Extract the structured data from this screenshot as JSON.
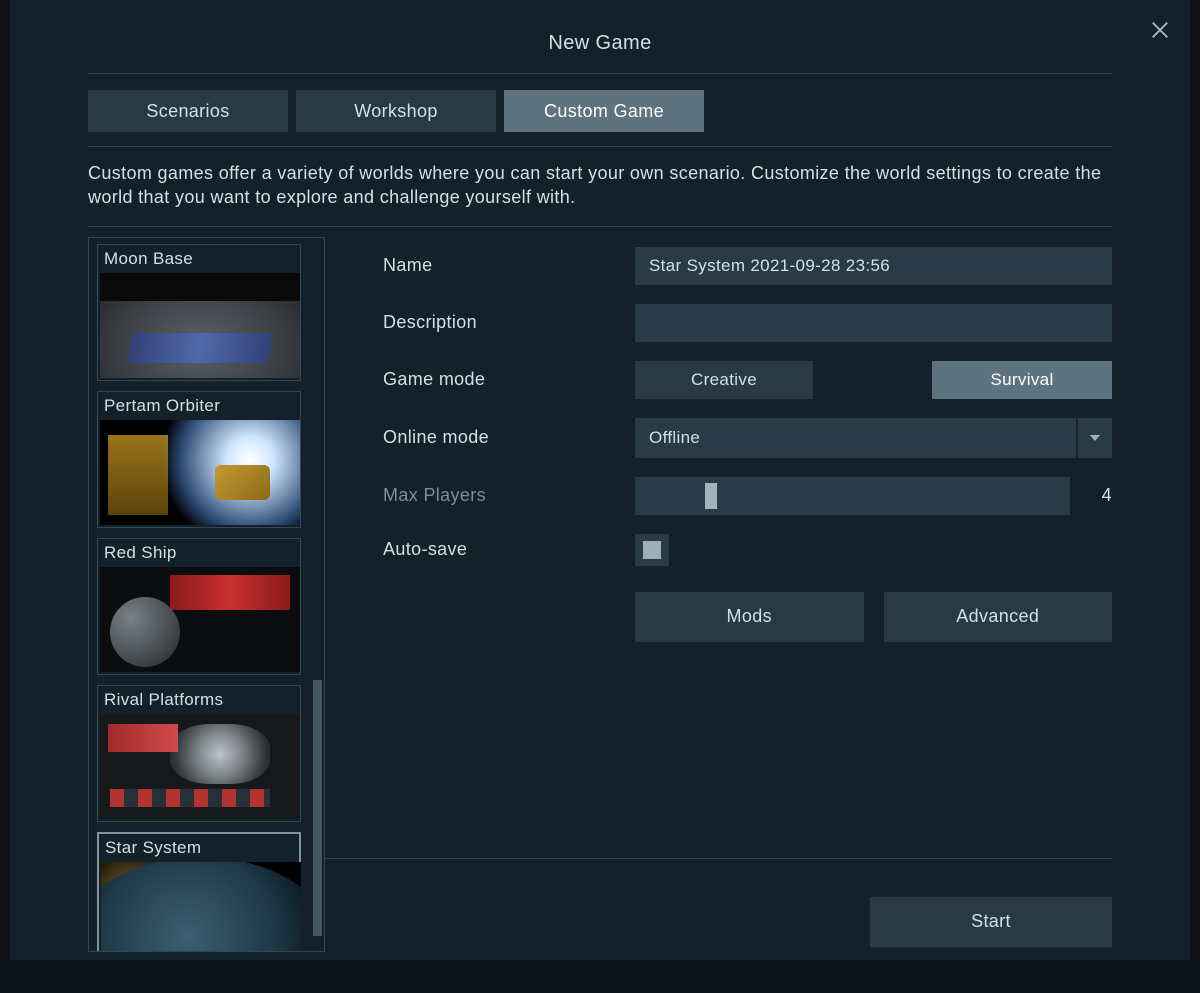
{
  "header": {
    "title": "New Game",
    "tabs": [
      "Scenarios",
      "Workshop",
      "Custom Game"
    ],
    "active_tab": 2
  },
  "description": "Custom games offer a variety of worlds where you can start your own scenario. Customize the world settings to create the world that you want to explore and challenge yourself with.",
  "scenarios": {
    "items": [
      {
        "title": "Moon Base",
        "selected": false
      },
      {
        "title": "Pertam Orbiter",
        "selected": false
      },
      {
        "title": "Red Ship",
        "selected": false
      },
      {
        "title": "Rival Platforms",
        "selected": false
      },
      {
        "title": "Star System",
        "selected": true
      }
    ],
    "scrollbar": {
      "thumb_top_pct": 62,
      "thumb_height_pct": 36
    }
  },
  "form": {
    "name_label": "Name",
    "name_value": "Star System 2021-09-28 23:56",
    "description_label": "Description",
    "description_value": "",
    "game_mode_label": "Game mode",
    "game_mode_options": [
      "Creative",
      "Survival"
    ],
    "game_mode_selected": 1,
    "online_mode_label": "Online mode",
    "online_mode_value": "Offline",
    "max_players_label": "Max Players",
    "max_players_value": "4",
    "max_players_slider_pct": 16,
    "autosave_label": "Auto-save",
    "autosave_checked": true,
    "mods_label": "Mods",
    "advanced_label": "Advanced",
    "start_label": "Start"
  }
}
